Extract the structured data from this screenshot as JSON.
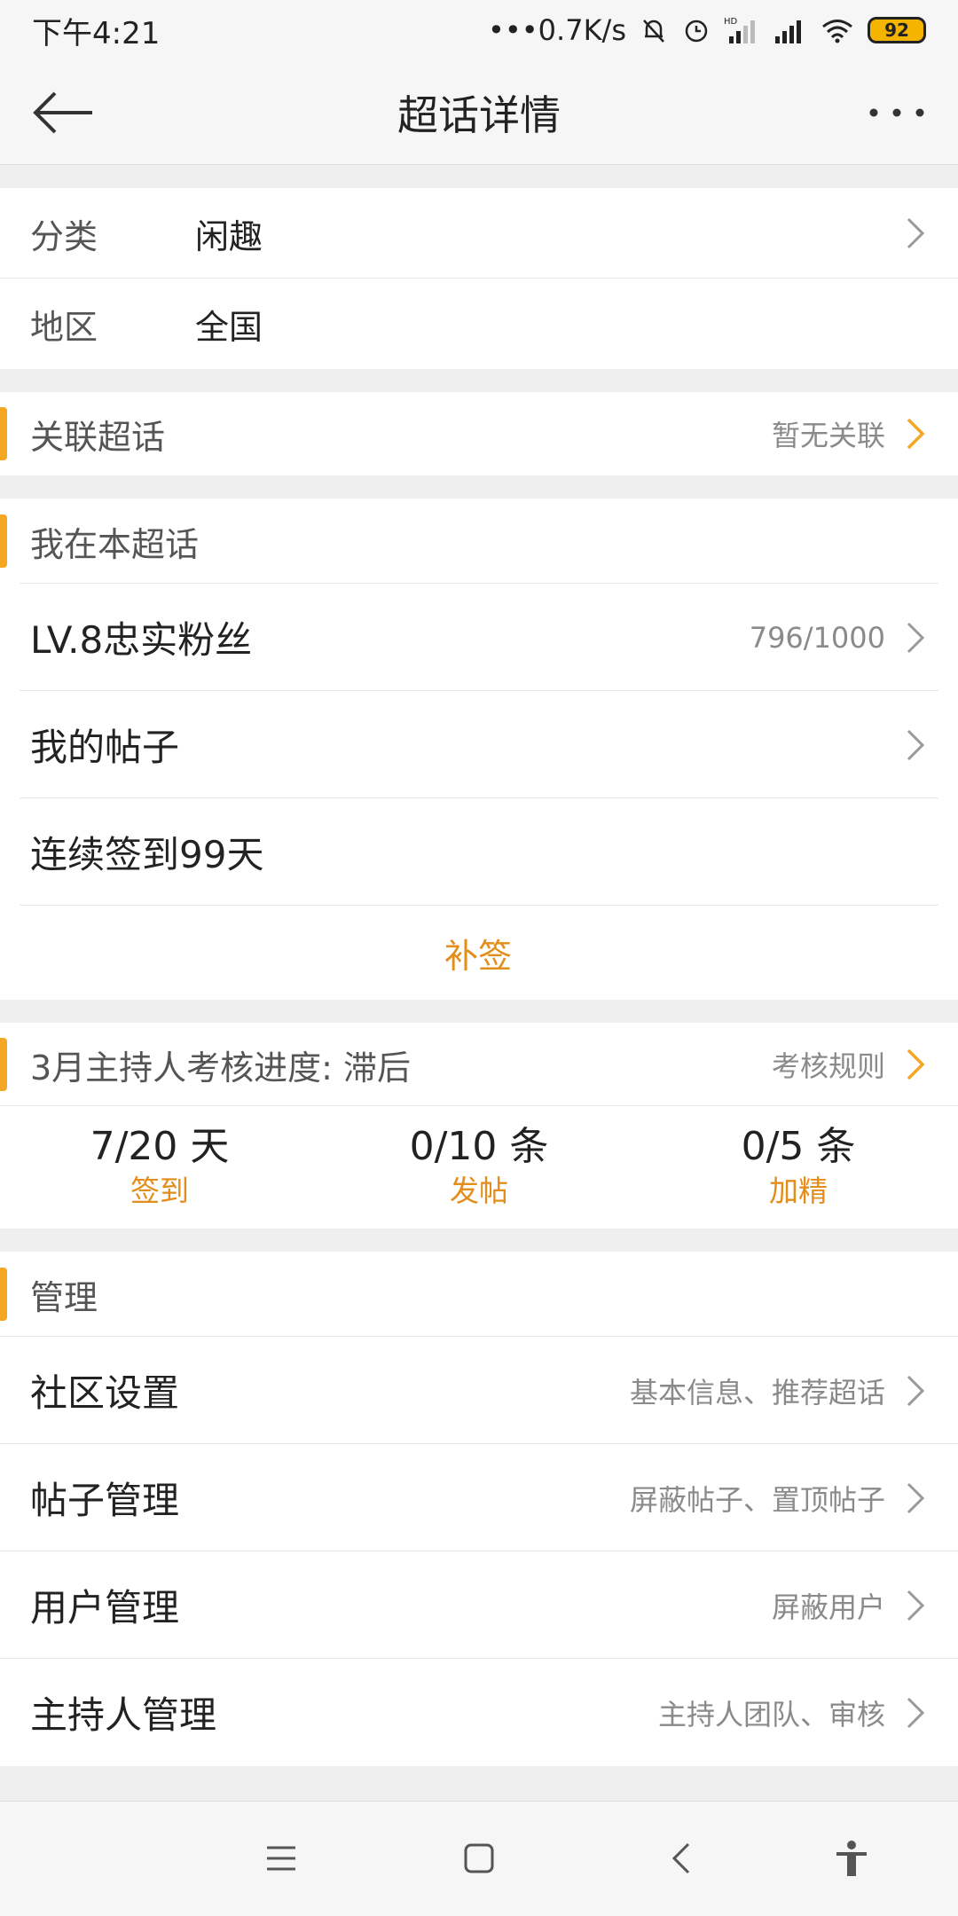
{
  "status_bar": {
    "time": "下午4:21",
    "network_speed": "•••0.7K/s",
    "battery": "92",
    "icons": [
      "bell-muted-icon",
      "alarm-icon",
      "hd-signal-icon",
      "signal-icon",
      "wifi-icon",
      "battery-icon"
    ]
  },
  "nav": {
    "title": "超话详情",
    "back_icon": "back-arrow-icon",
    "more_icon": "more-icon"
  },
  "info": {
    "category_label": "分类",
    "category_value": "闲趣",
    "region_label": "地区",
    "region_value": "全国"
  },
  "related": {
    "label": "关联超话",
    "value": "暂无关联"
  },
  "mine": {
    "header": "我在本超话",
    "level_label": "LV.8忠实粉丝",
    "level_progress": "796/1000",
    "posts_label": "我的帖子",
    "checkin_label": "连续签到99天",
    "makeup_label": "补签"
  },
  "host_review": {
    "title": "3月主持人考核进度: 滞后",
    "rules_label": "考核规则",
    "stats": [
      {
        "value": "7/20 天",
        "label": "签到"
      },
      {
        "value": "0/10 条",
        "label": "发帖"
      },
      {
        "value": "0/5 条",
        "label": "加精"
      }
    ]
  },
  "manage": {
    "header": "管理",
    "items": [
      {
        "label": "社区设置",
        "desc": "基本信息、推荐超话"
      },
      {
        "label": "帖子管理",
        "desc": "屏蔽帖子、置顶帖子"
      },
      {
        "label": "用户管理",
        "desc": "屏蔽用户"
      },
      {
        "label": "主持人管理",
        "desc": "主持人团队、审核"
      }
    ]
  },
  "bottom_nav": {
    "icons": [
      "menu-icon",
      "home-square-icon",
      "back-chevron-icon",
      "accessibility-icon"
    ]
  },
  "colors": {
    "accent": "#f5a623",
    "accent_text": "#e38d1b",
    "background": "#efefef"
  }
}
